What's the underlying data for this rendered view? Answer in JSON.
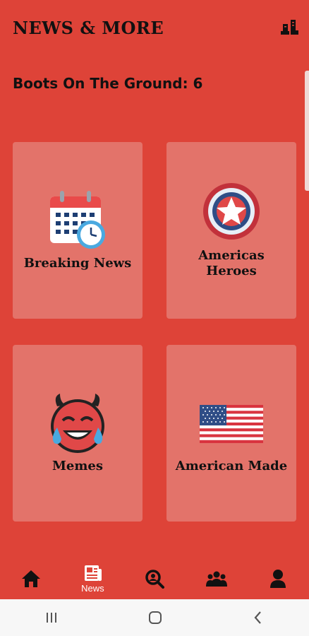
{
  "header": {
    "title": "NEWS & MORE",
    "icon": "boots-icon"
  },
  "status": {
    "boots_text": "Boots On The Ground: 6"
  },
  "tiles": [
    {
      "label": "Breaking News",
      "icon": "calendar-clock-icon"
    },
    {
      "label": "Americas Heroes",
      "icon": "star-shield-icon"
    },
    {
      "label": "Memes",
      "icon": "laughing-devil-icon"
    },
    {
      "label": "American Made",
      "icon": "us-flag-icon"
    }
  ],
  "bottom_nav": [
    {
      "icon": "home-icon",
      "label": ""
    },
    {
      "icon": "newspaper-icon",
      "label": "News"
    },
    {
      "icon": "search-icon",
      "label": ""
    },
    {
      "icon": "group-icon",
      "label": ""
    },
    {
      "icon": "profile-icon",
      "label": ""
    }
  ],
  "colors": {
    "background": "#de4338",
    "tile": "#e3736a",
    "system_bar": "#f7f7f7"
  }
}
